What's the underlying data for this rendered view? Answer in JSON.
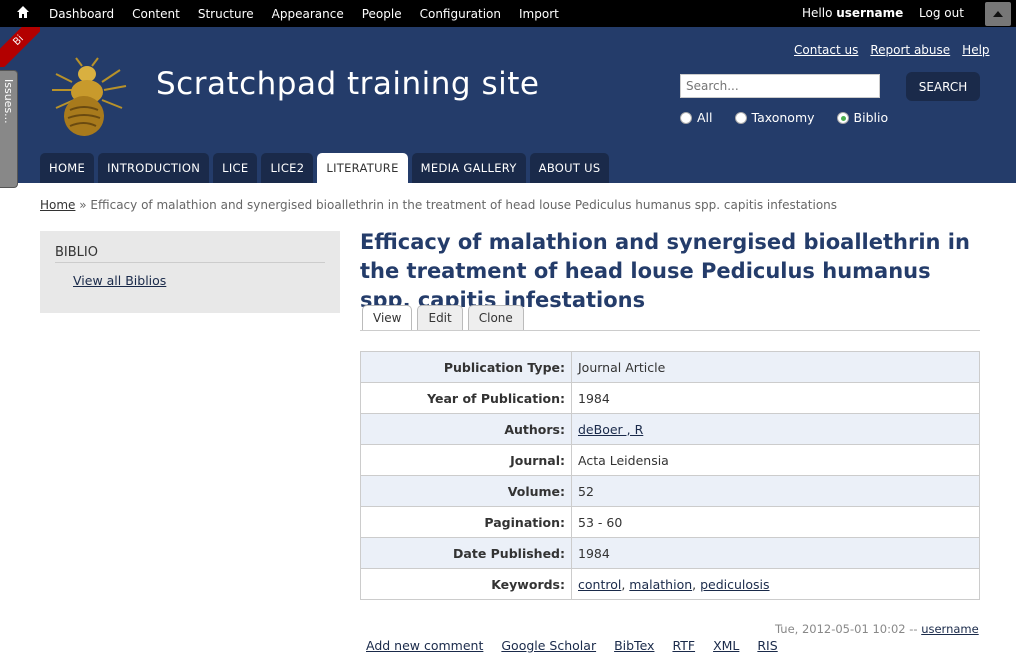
{
  "toolbar": {
    "menu": [
      "Dashboard",
      "Content",
      "Structure",
      "Appearance",
      "People",
      "Configuration",
      "Import"
    ],
    "hello_prefix": "Hello ",
    "username": "username",
    "logout": "Log out"
  },
  "ribbon": {
    "label": "Bi"
  },
  "issues_tab": {
    "label": "Issues..."
  },
  "site": {
    "name": "Scratchpad training site"
  },
  "secondary_links": [
    "Contact us",
    "Report abuse",
    "Help"
  ],
  "search": {
    "placeholder": "Search...",
    "button": "SEARCH",
    "options": [
      {
        "label": "All",
        "selected": false
      },
      {
        "label": "Taxonomy",
        "selected": false
      },
      {
        "label": "Biblio",
        "selected": true
      }
    ]
  },
  "nav": {
    "tabs": [
      "HOME",
      "INTRODUCTION",
      "LICE",
      "LICE2",
      "LITERATURE",
      "MEDIA GALLERY",
      "ABOUT US"
    ],
    "active": "LITERATURE"
  },
  "breadcrumb": {
    "home": "Home",
    "separator": " » ",
    "current": "Efficacy of malathion and synergised bioallethrin in the treatment of head louse Pediculus humanus spp. capitis infestations"
  },
  "sidebar": {
    "title": "BIBLIO",
    "link": "View all Biblios"
  },
  "page": {
    "title": "Efficacy of malathion and synergised bioallethrin in the treatment of head louse Pediculus humanus spp. capitis infestations",
    "tabs": [
      "View",
      "Edit",
      "Clone"
    ],
    "active_tab": "View"
  },
  "fields": [
    {
      "label": "Publication Type:",
      "value": "Journal Article"
    },
    {
      "label": "Year of Publication:",
      "value": "1984"
    },
    {
      "label": "Authors:",
      "links": [
        "deBoer , R"
      ]
    },
    {
      "label": "Journal:",
      "value": "Acta Leidensia"
    },
    {
      "label": "Volume:",
      "value": "52"
    },
    {
      "label": "Pagination:",
      "value": "53 - 60"
    },
    {
      "label": "Date Published:",
      "value": "1984"
    },
    {
      "label": "Keywords:",
      "links": [
        "control",
        "malathion",
        "pediculosis"
      ]
    }
  ],
  "submitted": {
    "date": "Tue, 2012-05-01 10:02 -- ",
    "user": "username"
  },
  "links": [
    "Add new comment",
    "Google Scholar",
    "BibTex",
    "RTF",
    "XML",
    "RIS"
  ],
  "colors": {
    "header_bg": "#243c6a",
    "tab_bg": "#1a2a4a",
    "row_alt": "#ebf0f8",
    "ribbon": "#b30000"
  }
}
